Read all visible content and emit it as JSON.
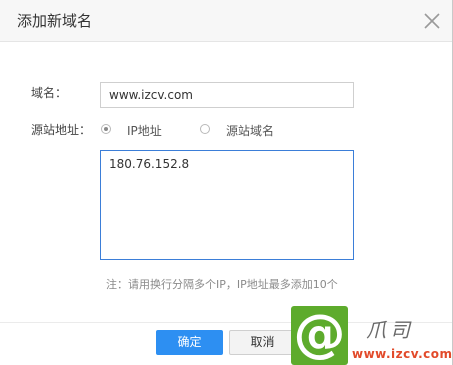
{
  "dialog": {
    "title": "添加新域名"
  },
  "form": {
    "domain_label": "域名：",
    "domain_value": "www.izcv.com",
    "source_label": "源站地址：",
    "source_options": [
      {
        "label": "IP地址",
        "checked": true
      },
      {
        "label": "源站域名",
        "checked": false
      }
    ],
    "ip_value": "180.76.152.8",
    "note": "注：请用换行分隔多个IP，IP地址最多添加10个"
  },
  "footer": {
    "confirm_label": "确定",
    "cancel_label": "取消"
  },
  "watermark": {
    "logo_glyph": "@",
    "script_text": "爪司",
    "url": "www.izcv.com"
  },
  "icons": {
    "close": "close-icon"
  },
  "colors": {
    "primary": "#2d8ff2",
    "watermark_green": "#5dab2c",
    "watermark_red": "#e24a2a"
  }
}
